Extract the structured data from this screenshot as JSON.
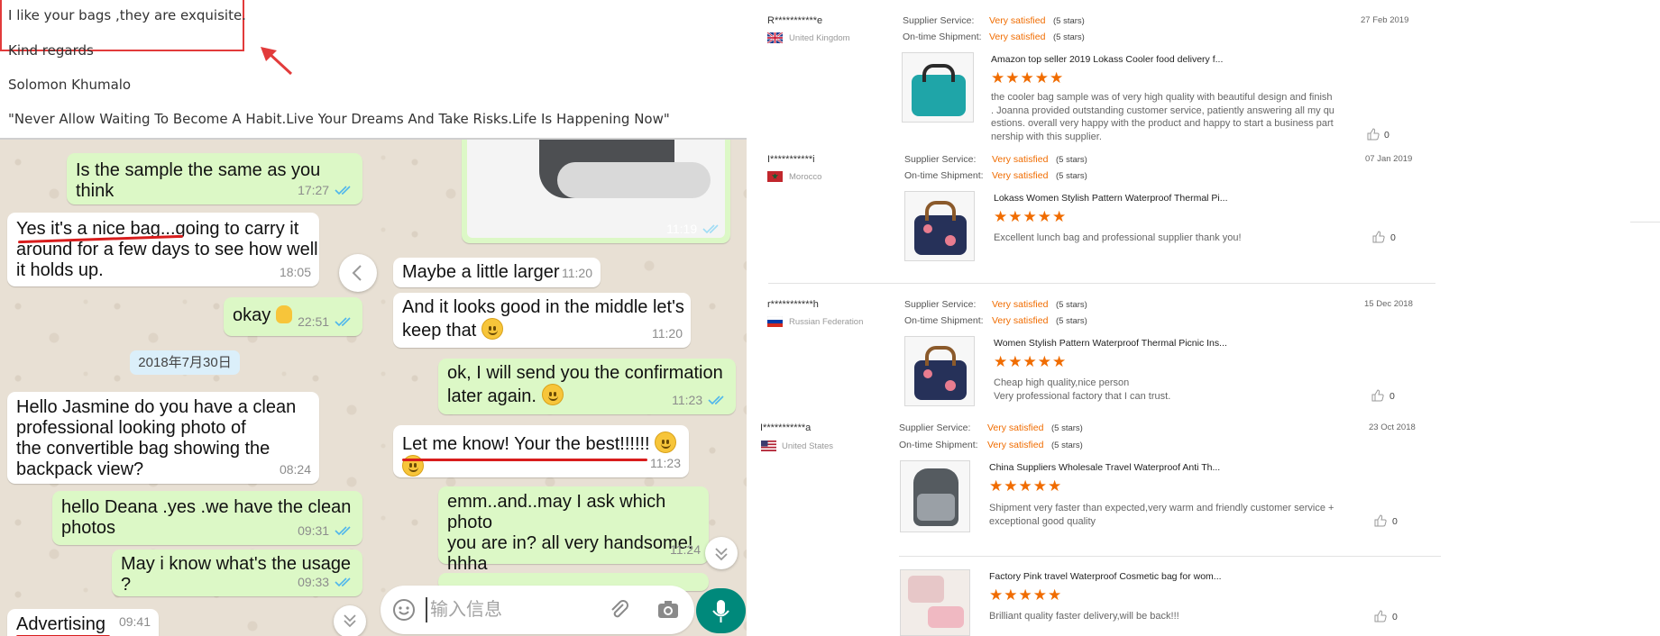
{
  "email": {
    "line1": "I like your bags ,they are exquisite.",
    "line2": "Kind regards",
    "line3": "Solomon Khumalo",
    "line4": "\"Never Allow Waiting To Become A Habit.Live Your Dreams And Take Risks.Life Is Happening Now\""
  },
  "chat": {
    "messages": [
      {
        "text": "Is the sample the same as you think",
        "time": "17:27"
      },
      {
        "time": "11:19"
      },
      {
        "text1": "Yes it's a nice bag...going to carry it",
        "text2": "around for a few days to see how well",
        "text3": "it holds up.",
        "time": "18:05"
      },
      {
        "text": "Maybe a little larger",
        "time": "11:20"
      },
      {
        "text1": "And it looks good in the middle let's",
        "text2": "keep that",
        "time": "11:20"
      },
      {
        "text": "okay",
        "time": "22:51"
      },
      {
        "text1": "ok, I will send you the confirmation",
        "text2": "later again.",
        "time": "11:23"
      },
      {
        "text1": "Hello Jasmine do you have a clean",
        "text2": "professional looking photo of",
        "text3": "the convertible bag showing the",
        "text4": "backpack view?",
        "time": "08:24"
      },
      {
        "text": "Let me know! Your the best!!!!!!",
        "time": "11:23"
      },
      {
        "text1": "hello Deana .yes .we have the clean",
        "text2": "photos",
        "time": "09:31"
      },
      {
        "text1": "emm..and..may I ask which photo",
        "text2": "you are in? all very handsome! hhha",
        "time": "11:24"
      },
      {
        "text": "May i know what's the usage ?",
        "time": "09:33"
      },
      {
        "text": "Advertising",
        "time": "09:41"
      }
    ],
    "date_chip": "2018年7月30日",
    "input_placeholder": "输入信息"
  },
  "reviews": {
    "supplier_service_label": "Supplier Service:",
    "on_time_label": "On-time Shipment:",
    "satisfied": "Very satisfied",
    "five_stars": "(5 stars)",
    "rating_stars": "★★★★★",
    "items": [
      {
        "user": "R***********e",
        "country": "United Kingdom",
        "date": "27 Feb 2019",
        "product": "Amazon top seller 2019 Lokass Cooler food delivery f...",
        "text": [
          "the cooler bag sample was of very high quality with beautiful design and finish",
          ". Joanna provided outstanding customer service, patiently answering all my qu",
          "estions. overall very happy with the product and happy to start a business part",
          "nership with this supplier."
        ],
        "likes": "0"
      },
      {
        "user": "I***********i",
        "country": "Morocco",
        "date": "07 Jan 2019",
        "product": "Lokass Women Stylish Pattern Waterproof Thermal Pi...",
        "text": [
          "Excellent lunch bag  and professional supplier thank you!"
        ],
        "likes": "0"
      },
      {
        "user": "r***********h",
        "country": "Russian Federation",
        "date": "15 Dec 2018",
        "product": "Women Stylish Pattern Waterproof Thermal Picnic Ins...",
        "text": [
          "Cheap high quality,nice person",
          "Very professional factory that I can trust."
        ],
        "likes": "0"
      },
      {
        "user": "I***********a",
        "country": "United States",
        "date": "23 Oct 2018",
        "product": "China Suppliers Wholesale Travel Waterproof Anti Th...",
        "text": [
          "Shipment very faster than expected,very warm and friendly customer service +",
          "exceptional good quality"
        ],
        "likes": "0"
      },
      {
        "product": "Factory Pink travel Waterproof Cosmetic bag for wom...",
        "text": [
          "Brilliant quality faster delivery,will be back!!!"
        ],
        "likes": "0"
      }
    ]
  }
}
